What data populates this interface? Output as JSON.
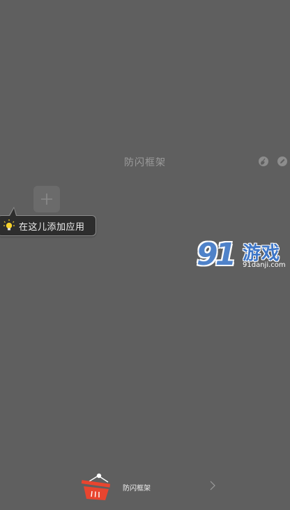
{
  "folder": {
    "title": "防闪框架"
  },
  "tooltip": {
    "text": "在这儿添加应用"
  },
  "watermark": {
    "number": "91",
    "brand": "游戏",
    "domain": "91danji.com"
  },
  "bottom_bar": {
    "label": "防闪框架"
  },
  "colors": {
    "background": "#5f5f5f",
    "tooltip_bg": "#2d2d2d",
    "basket_red": "#e8452f",
    "bulb_yellow": "#f6d22b"
  },
  "icons": {
    "clean": "broom-icon",
    "edit": "pencil-icon",
    "add": "plus-icon",
    "tip": "lightbulb-icon",
    "basket": "shopping-basket-icon",
    "chevron": "chevron-right-icon"
  }
}
